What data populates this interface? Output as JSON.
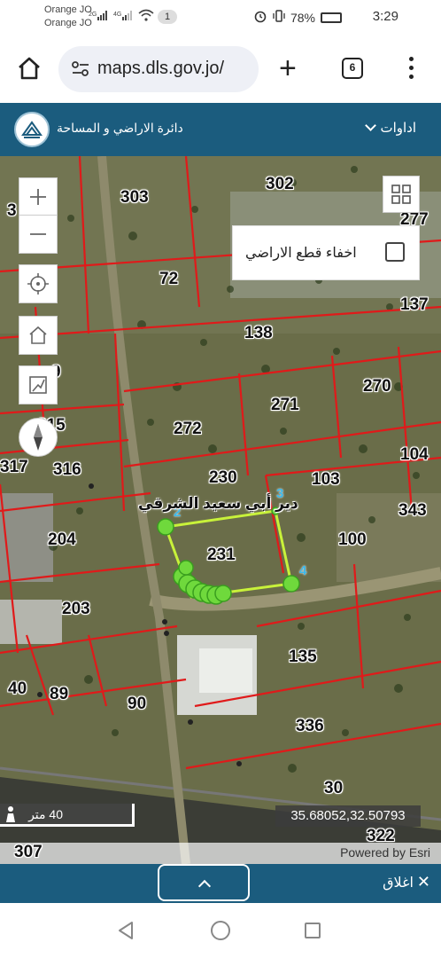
{
  "status": {
    "carrier1": "Orange JO",
    "carrier2": "Orange JO",
    "network1": "2G",
    "network2": "4G",
    "notifications": "1",
    "battery": "78%",
    "time": "3:29"
  },
  "browser": {
    "url": "maps.dls.gov.jo/",
    "tab_count": "6"
  },
  "app": {
    "title": "دائرة الاراضي و المساحة",
    "tools_label": "اداوات"
  },
  "map": {
    "hide_parcels_label": "اخفاء قطع الاراضي",
    "scale_label": "40 متر",
    "coordinates": "35.68052,32.50793",
    "attribution": "Powered by Esri",
    "place_name": "دير أبي سعيد الشرقي",
    "parcels": [
      "303",
      "302",
      "277",
      "3",
      "72",
      "137",
      "138",
      "270",
      "271",
      "272",
      "215",
      "9",
      "317",
      "316",
      "230",
      "103",
      "104",
      "343",
      "204",
      "231",
      "100",
      "203",
      "135",
      "40",
      "89",
      "90",
      "336",
      "30",
      "322",
      "307"
    ],
    "vertices": [
      "2",
      "3",
      "4"
    ]
  },
  "bottom": {
    "close_label": "اغلاق"
  }
}
